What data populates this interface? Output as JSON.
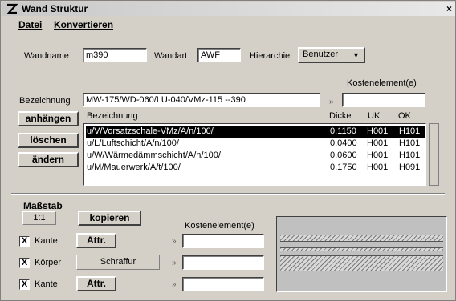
{
  "window": {
    "title": "Wand Struktur",
    "close_glyph": "×",
    "app_icon": "wand-structure-icon"
  },
  "menu": {
    "items": [
      "Datei",
      "Konvertieren"
    ]
  },
  "header": {
    "wandname_label": "Wandname",
    "wandname_value": "m390",
    "wandart_label": "Wandart",
    "wandart_value": "AWF",
    "hierarchie_label": "Hierarchie",
    "hierarchie_value": "Benutzer",
    "dropdown_glyph": "▼"
  },
  "bezeichnung": {
    "label": "Bezeichnung",
    "value": "MW-175/WD-060/LU-040/VMz-115 --390",
    "kosten_label": "Kostenelement(e)",
    "kosten_value": "",
    "arrow_glyph": "»"
  },
  "actions": {
    "append": "anhängen",
    "delete": "löschen",
    "change": "ändern"
  },
  "layers": {
    "columns": [
      "Bezeichnung",
      "Dicke",
      "UK",
      "OK"
    ],
    "rows": [
      [
        "u/V/Vorsatzschale-VMz/A/n/100/",
        "0.1150",
        "H001",
        "H101"
      ],
      [
        "u/L/Luftschicht/A/n/100/",
        "0.0400",
        "H001",
        "H101"
      ],
      [
        "u/W/Wärmedämmschicht/A/n/100/",
        "0.0600",
        "H001",
        "H101"
      ],
      [
        "u/M/Mauerwerk/A/t/100/",
        "0.1750",
        "H001",
        "H091"
      ]
    ]
  },
  "massstab": {
    "label": "Maßstab",
    "scale": "1:1",
    "copy": "kopieren",
    "kosten_label": "Kostenelement(e)"
  },
  "properties": [
    {
      "checked": "X",
      "label": "Kante",
      "button": "Attr.",
      "kosten_value": ""
    },
    {
      "checked": "X",
      "label": "Körper",
      "button": "Schraffur",
      "kosten_value": ""
    },
    {
      "checked": "X",
      "label": "Kante",
      "button": "Attr.",
      "kosten_value": ""
    }
  ],
  "arrow": "»"
}
